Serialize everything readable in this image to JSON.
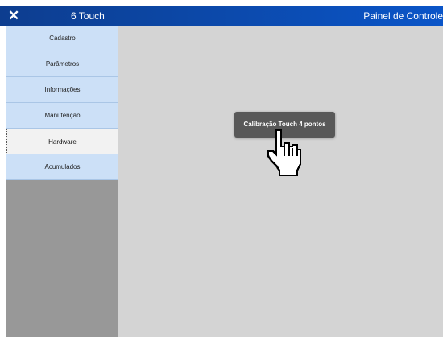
{
  "titlebar": {
    "close_icon": "close-icon",
    "close_glyph": "✕",
    "app_title": "6 Touch",
    "panel_title": "Painel de Controle",
    "color": "#0c48a8"
  },
  "sidebar": {
    "items": [
      {
        "label": "Cadastro"
      },
      {
        "label": "Parâmetros"
      },
      {
        "label": "Informações"
      },
      {
        "label": "Manutenção"
      },
      {
        "label": "Hardware",
        "active": true
      },
      {
        "label": "Acumulados"
      }
    ],
    "item_color": "#cce0f7",
    "background": "#989898"
  },
  "main": {
    "calibrate_button_label": "Calibração Touch 4 pontos",
    "cursor_icon": "hand-pointer-icon",
    "background": "#d4d4d4"
  }
}
